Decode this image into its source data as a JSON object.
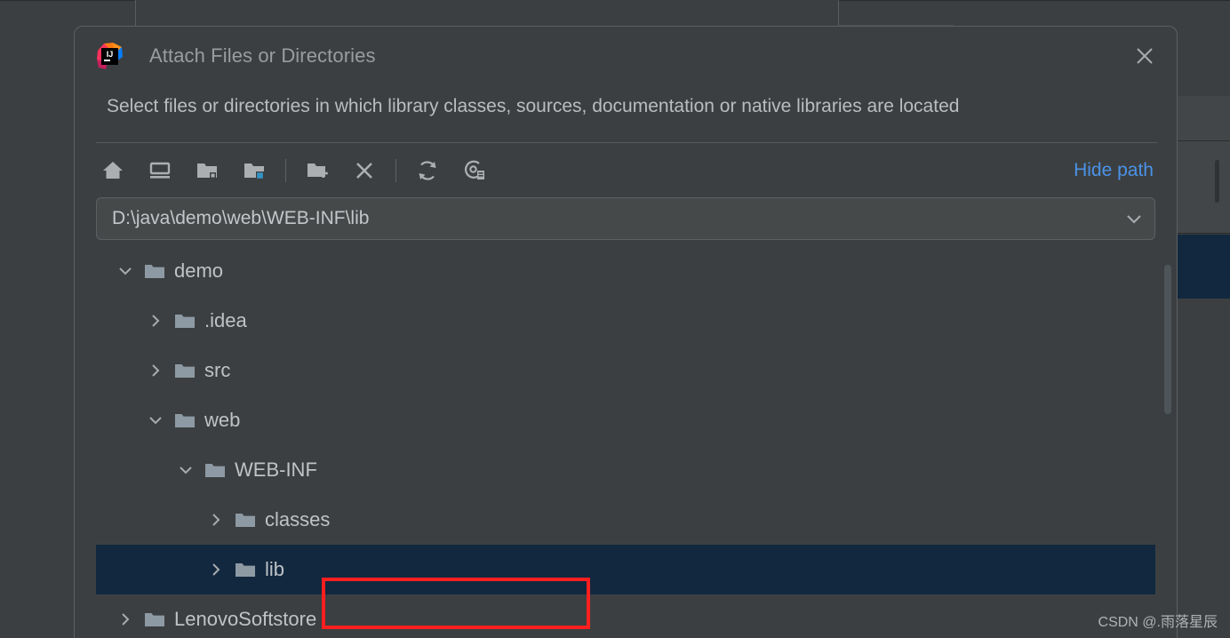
{
  "dialog": {
    "title": "Attach Files or Directories",
    "logo_icon": "intellij-idea-logo",
    "close_icon": "close-icon",
    "description": "Select files or directories in which library classes, sources, documentation or native libraries are located",
    "hide_path_label": "Hide path",
    "toolbar": [
      {
        "name": "home-icon",
        "tooltip": "Home"
      },
      {
        "name": "desktop-icon",
        "tooltip": "Desktop"
      },
      {
        "name": "folder-module-icon",
        "tooltip": "Module Directory"
      },
      {
        "name": "folder-project-icon",
        "tooltip": "Project Directory"
      },
      {
        "name": "new-folder-icon",
        "tooltip": "New Folder"
      },
      {
        "name": "delete-icon",
        "tooltip": "Delete"
      },
      {
        "name": "refresh-icon",
        "tooltip": "Refresh"
      },
      {
        "name": "show-hidden-files-icon",
        "tooltip": "Show Hidden Files and Directories"
      }
    ],
    "path": {
      "value": "D:\\java\\demo\\web\\WEB-INF\\lib",
      "placeholder": "",
      "chevron_icon": "chevron-down-icon"
    },
    "tree": [
      {
        "label": "demo",
        "indent": 0,
        "state": "expanded",
        "selected": false
      },
      {
        "label": ".idea",
        "indent": 1,
        "state": "collapsed",
        "selected": false
      },
      {
        "label": "src",
        "indent": 1,
        "state": "collapsed",
        "selected": false
      },
      {
        "label": "web",
        "indent": 1,
        "state": "expanded",
        "selected": false
      },
      {
        "label": "WEB-INF",
        "indent": 2,
        "state": "expanded",
        "selected": false
      },
      {
        "label": "classes",
        "indent": 3,
        "state": "collapsed",
        "selected": false
      },
      {
        "label": "lib",
        "indent": 3,
        "state": "collapsed",
        "selected": true
      },
      {
        "label": "LenovoSoftstore",
        "indent": 0,
        "state": "collapsed",
        "selected": false
      }
    ]
  },
  "colors": {
    "dialog_bg": "#3c3f41",
    "selection_blue": "#12283f",
    "link_blue": "#4a93e8",
    "annotation_red": "#ff1f1f",
    "tab_underline_blue": "#4a88c7",
    "text_primary": "#bfc3c6"
  },
  "annotation": {
    "name": "red-highlight-box"
  },
  "watermark": {
    "text": "CSDN @.雨落星辰"
  }
}
